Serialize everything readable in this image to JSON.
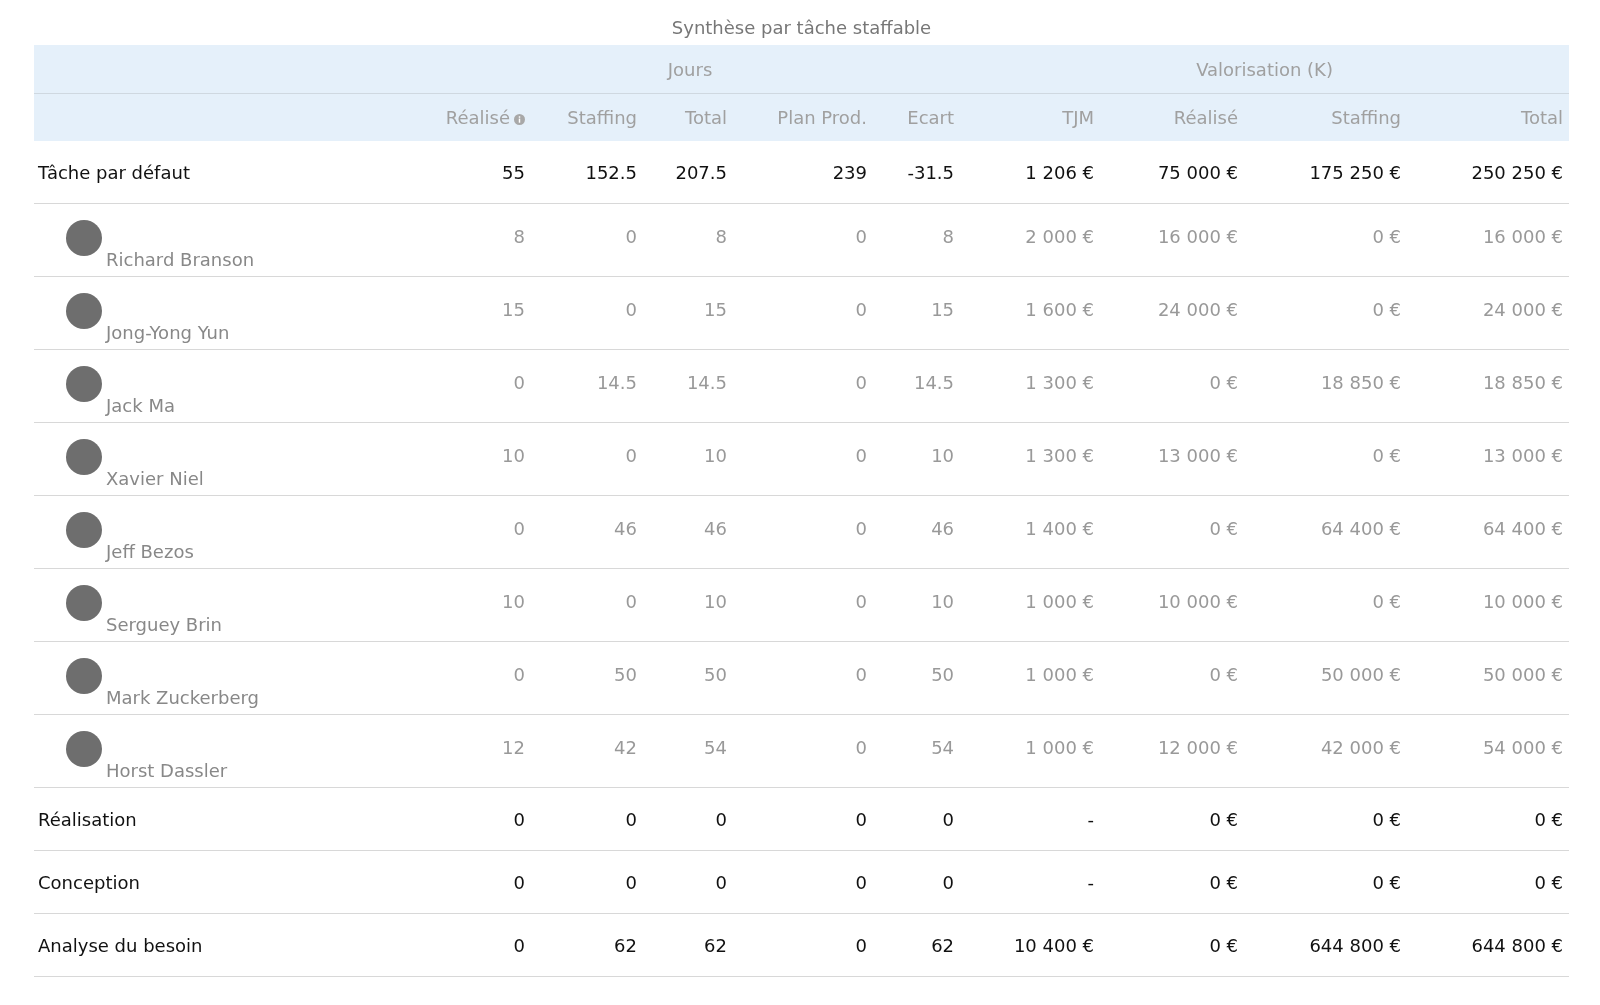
{
  "title": "Synthèse par tâche staffable",
  "column_groups": [
    {
      "label": "Jours",
      "columns": [
        {
          "label": "Réalisé",
          "info": true
        },
        {
          "label": "Staffing"
        },
        {
          "label": "Total"
        },
        {
          "label": "Plan Prod."
        },
        {
          "label": "Ecart"
        }
      ]
    },
    {
      "label": "Valorisation (K)",
      "columns": [
        {
          "label": "TJM"
        },
        {
          "label": "Réalisé"
        },
        {
          "label": "Staffing"
        },
        {
          "label": "Total"
        }
      ]
    }
  ],
  "rows": [
    {
      "kind": "task",
      "name": "Tâche par défaut",
      "cells": [
        "55",
        "152.5",
        "207.5",
        "239",
        "-31.5",
        "1 206 €",
        "75 000 €",
        "175 250 €",
        "250 250 €"
      ]
    },
    {
      "kind": "person",
      "name": "Richard Branson",
      "cells": [
        "8",
        "0",
        "8",
        "0",
        "8",
        "2 000 €",
        "16 000 €",
        "0 €",
        "16 000 €"
      ]
    },
    {
      "kind": "person",
      "name": "Jong-Yong Yun",
      "cells": [
        "15",
        "0",
        "15",
        "0",
        "15",
        "1 600 €",
        "24 000 €",
        "0 €",
        "24 000 €"
      ]
    },
    {
      "kind": "person",
      "name": "Jack Ma",
      "cells": [
        "0",
        "14.5",
        "14.5",
        "0",
        "14.5",
        "1 300 €",
        "0 €",
        "18 850 €",
        "18 850 €"
      ]
    },
    {
      "kind": "person",
      "name": "Xavier Niel",
      "cells": [
        "10",
        "0",
        "10",
        "0",
        "10",
        "1 300 €",
        "13 000 €",
        "0 €",
        "13 000 €"
      ]
    },
    {
      "kind": "person",
      "name": "Jeff Bezos",
      "cells": [
        "0",
        "46",
        "46",
        "0",
        "46",
        "1 400 €",
        "0 €",
        "64 400 €",
        "64 400 €"
      ]
    },
    {
      "kind": "person",
      "name": "Serguey Brin",
      "cells": [
        "10",
        "0",
        "10",
        "0",
        "10",
        "1 000 €",
        "10 000 €",
        "0 €",
        "10 000 €"
      ]
    },
    {
      "kind": "person",
      "name": "Mark Zuckerberg",
      "cells": [
        "0",
        "50",
        "50",
        "0",
        "50",
        "1 000 €",
        "0 €",
        "50 000 €",
        "50 000 €"
      ]
    },
    {
      "kind": "person",
      "name": "Horst Dassler",
      "cells": [
        "12",
        "42",
        "54",
        "0",
        "54",
        "1 000 €",
        "12 000 €",
        "42 000 €",
        "54 000 €"
      ]
    },
    {
      "kind": "task",
      "name": "Réalisation",
      "cells": [
        "0",
        "0",
        "0",
        "0",
        "0",
        "-",
        "0 €",
        "0 €",
        "0 €"
      ]
    },
    {
      "kind": "task",
      "name": "Conception",
      "cells": [
        "0",
        "0",
        "0",
        "0",
        "0",
        "-",
        "0 €",
        "0 €",
        "0 €"
      ]
    },
    {
      "kind": "task",
      "name": "Analyse du besoin",
      "cells": [
        "0",
        "62",
        "62",
        "0",
        "62",
        "10 400 €",
        "0 €",
        "644 800 €",
        "644 800 €"
      ]
    }
  ]
}
